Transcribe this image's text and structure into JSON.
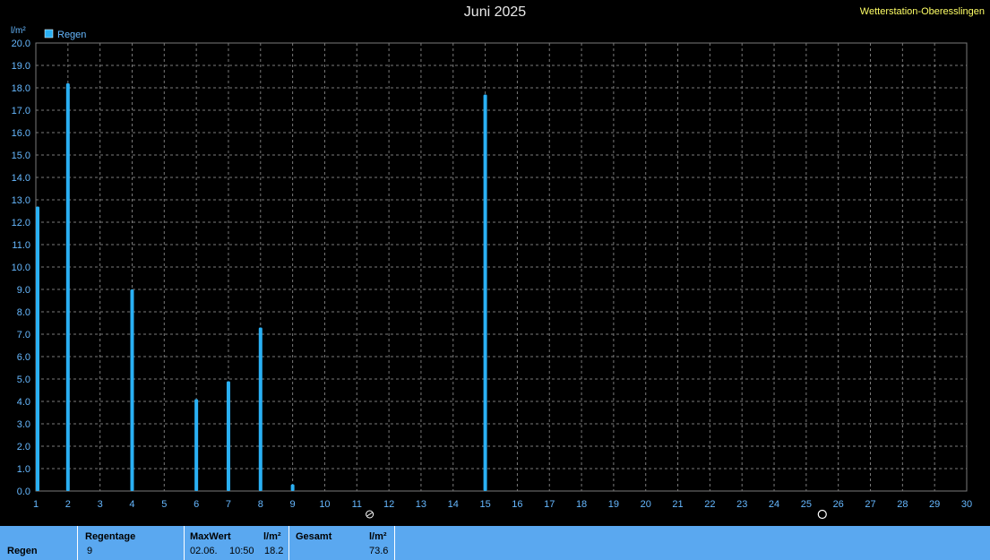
{
  "station": "Wetterstation-Oberesslingen",
  "colors": {
    "background": "#000000",
    "bar": "#2ab0f4",
    "axis_text": "#66b8ff",
    "grid": "#7a7a7a",
    "stats_bg": "#5aa8f0"
  },
  "chart_data": {
    "type": "bar",
    "title": "Juni 2025",
    "ylabel": "l/m²",
    "xlabel": "",
    "ylim": [
      0,
      20
    ],
    "yticks": [
      "0.0",
      "1.0",
      "2.0",
      "3.0",
      "4.0",
      "5.0",
      "6.0",
      "7.0",
      "8.0",
      "9.0",
      "10.0",
      "11.0",
      "12.0",
      "13.0",
      "14.0",
      "15.0",
      "16.0",
      "17.0",
      "18.0",
      "19.0",
      "20.0"
    ],
    "xticks": [
      "1",
      "2",
      "3",
      "4",
      "5",
      "6",
      "7",
      "8",
      "9",
      "10",
      "11",
      "12",
      "13",
      "14",
      "15",
      "16",
      "17",
      "18",
      "19",
      "20",
      "21",
      "22",
      "23",
      "24",
      "25",
      "26",
      "27",
      "28",
      "29",
      "30"
    ],
    "legend_position": "top-left",
    "grid": true,
    "series": [
      {
        "name": "Regen",
        "x": [
          1,
          2,
          4,
          6,
          7,
          8,
          9,
          15
        ],
        "values": [
          12.7,
          18.2,
          9.0,
          4.1,
          4.9,
          7.3,
          0.3,
          17.7
        ]
      }
    ]
  },
  "stats": {
    "row_label": "Regen",
    "regentage": {
      "label": "Regentage",
      "value": "9"
    },
    "maxwert": {
      "label": "MaxWert",
      "unit": "l/m²",
      "date": "02.06.",
      "time": "10:50",
      "value": "18.2"
    },
    "gesamt": {
      "label": "Gesamt",
      "unit": "l/m²",
      "value": "73.6"
    }
  }
}
